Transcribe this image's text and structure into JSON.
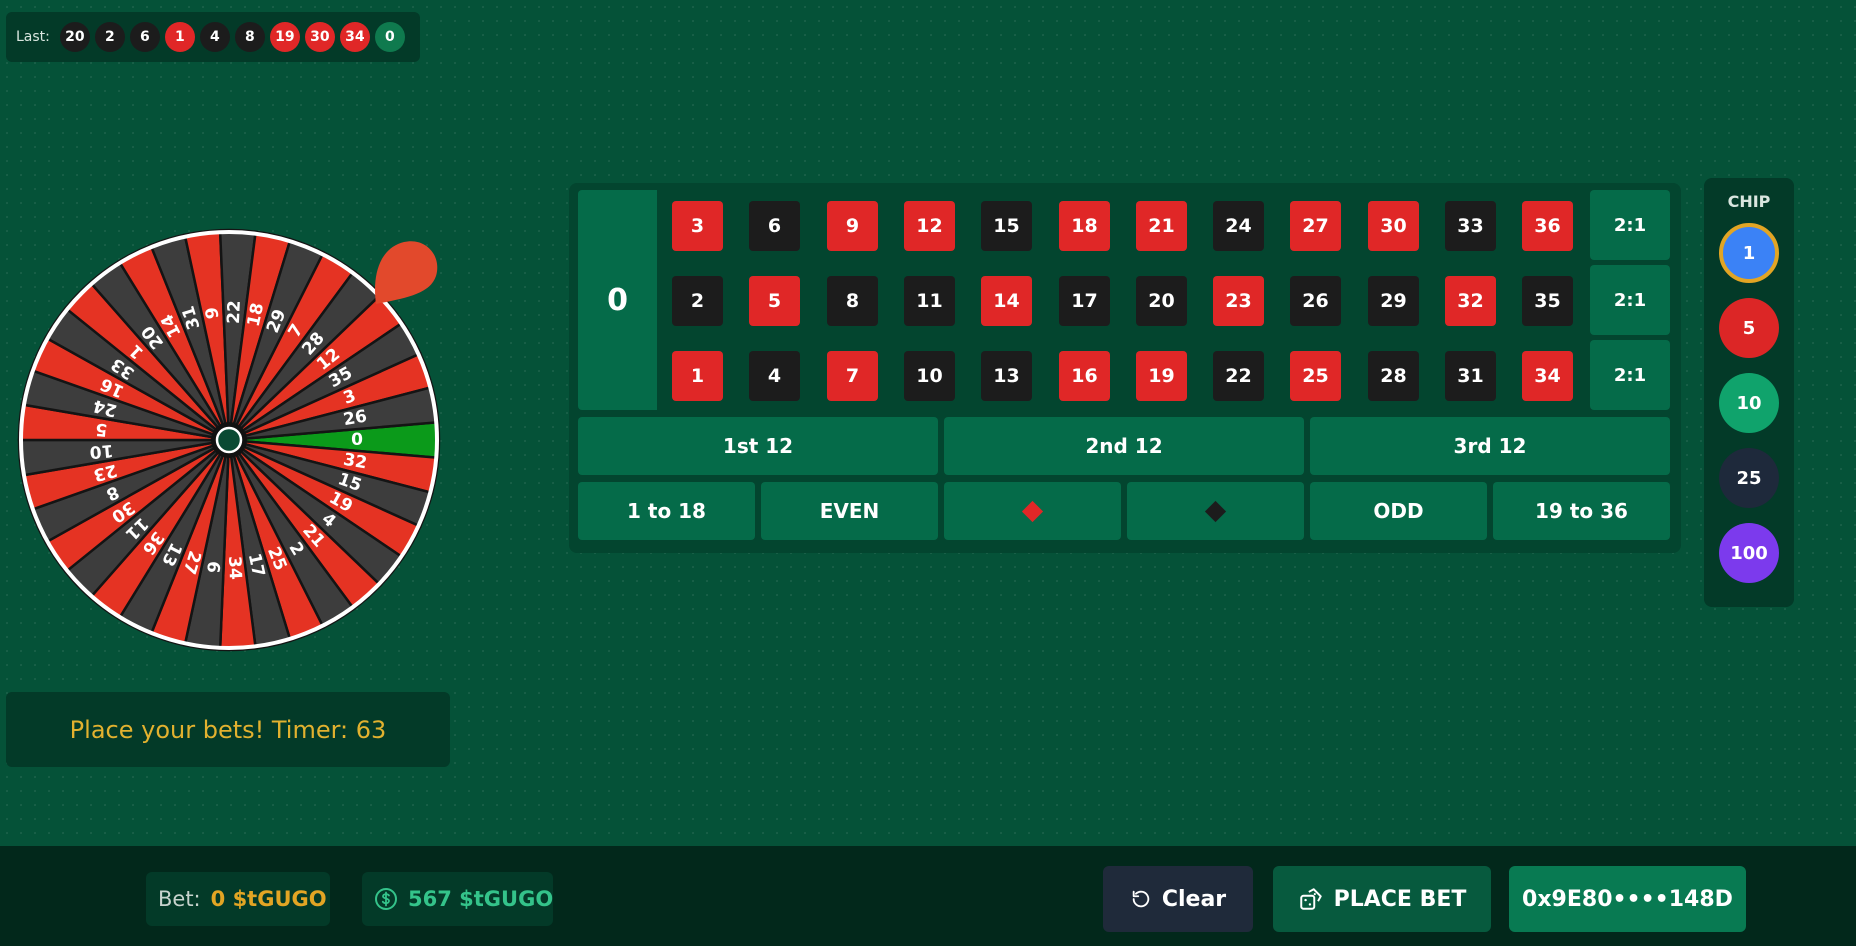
{
  "last_results": {
    "label": "Last:",
    "numbers": [
      {
        "value": "20",
        "color": "#1c1c1c"
      },
      {
        "value": "2",
        "color": "#1c1c1c"
      },
      {
        "value": "6",
        "color": "#1c1c1c"
      },
      {
        "value": "1",
        "color": "#e02727"
      },
      {
        "value": "4",
        "color": "#1c1c1c"
      },
      {
        "value": "8",
        "color": "#1c1c1c"
      },
      {
        "value": "19",
        "color": "#e02727"
      },
      {
        "value": "30",
        "color": "#e02727"
      },
      {
        "value": "34",
        "color": "#e02727"
      },
      {
        "value": "0",
        "color": "#0f7a4e"
      }
    ]
  },
  "wheel": {
    "sequence": [
      "0",
      "32",
      "15",
      "19",
      "4",
      "21",
      "2",
      "25",
      "17",
      "34",
      "6",
      "27",
      "13",
      "36",
      "11",
      "30",
      "8",
      "23",
      "10",
      "5",
      "24",
      "16",
      "33",
      "1",
      "20",
      "14",
      "31",
      "9",
      "22",
      "18",
      "29",
      "7",
      "28",
      "12",
      "35",
      "3",
      "26"
    ],
    "red_numbers": [
      1,
      3,
      5,
      7,
      9,
      12,
      14,
      16,
      18,
      19,
      21,
      23,
      25,
      27,
      30,
      32,
      34,
      36
    ],
    "colors": {
      "red": "#e53323",
      "black": "#3d3d3d",
      "green": "#0b9a1a",
      "rim": "#ffffff",
      "divider": "#141414",
      "pointer": "#e2492c"
    }
  },
  "status_message": "Place your bets! Timer: 63",
  "table": {
    "zero": "0",
    "rows": [
      [
        {
          "n": "3",
          "c": "red"
        },
        {
          "n": "6",
          "c": "black"
        },
        {
          "n": "9",
          "c": "red"
        },
        {
          "n": "12",
          "c": "red"
        },
        {
          "n": "15",
          "c": "black"
        },
        {
          "n": "18",
          "c": "red"
        },
        {
          "n": "21",
          "c": "red"
        },
        {
          "n": "24",
          "c": "black"
        },
        {
          "n": "27",
          "c": "red"
        },
        {
          "n": "30",
          "c": "red"
        },
        {
          "n": "33",
          "c": "black"
        },
        {
          "n": "36",
          "c": "red"
        }
      ],
      [
        {
          "n": "2",
          "c": "black"
        },
        {
          "n": "5",
          "c": "red"
        },
        {
          "n": "8",
          "c": "black"
        },
        {
          "n": "11",
          "c": "black"
        },
        {
          "n": "14",
          "c": "red"
        },
        {
          "n": "17",
          "c": "black"
        },
        {
          "n": "20",
          "c": "black"
        },
        {
          "n": "23",
          "c": "red"
        },
        {
          "n": "26",
          "c": "black"
        },
        {
          "n": "29",
          "c": "black"
        },
        {
          "n": "32",
          "c": "red"
        },
        {
          "n": "35",
          "c": "black"
        }
      ],
      [
        {
          "n": "1",
          "c": "red"
        },
        {
          "n": "4",
          "c": "black"
        },
        {
          "n": "7",
          "c": "red"
        },
        {
          "n": "10",
          "c": "black"
        },
        {
          "n": "13",
          "c": "black"
        },
        {
          "n": "16",
          "c": "red"
        },
        {
          "n": "19",
          "c": "red"
        },
        {
          "n": "22",
          "c": "black"
        },
        {
          "n": "25",
          "c": "red"
        },
        {
          "n": "28",
          "c": "black"
        },
        {
          "n": "31",
          "c": "black"
        },
        {
          "n": "34",
          "c": "red"
        }
      ]
    ],
    "column_bets": [
      "2:1",
      "2:1",
      "2:1"
    ],
    "dozens": [
      "1st 12",
      "2nd 12",
      "3rd 12"
    ],
    "low_label": "1 to 18",
    "even_label": "EVEN",
    "odd_label": "ODD",
    "high_label": "19 to 36",
    "colors": {
      "red": "#e02727",
      "black": "#1c1c1c"
    }
  },
  "chips": {
    "title": "CHIP",
    "items": [
      {
        "value": "1",
        "color": "#3b82f6",
        "selected": true
      },
      {
        "value": "5",
        "color": "#dc2626",
        "selected": false
      },
      {
        "value": "10",
        "color": "#10a36c",
        "selected": false
      },
      {
        "value": "25",
        "color": "#1e293b",
        "selected": false
      },
      {
        "value": "100",
        "color": "#7c3aed",
        "selected": false
      }
    ],
    "selected_ring_color": "#e2a524"
  },
  "footer": {
    "bet_label": "Bet:",
    "bet_value": "0 $tGUGO",
    "balance_value": "567 $tGUGO",
    "clear_label": "Clear",
    "place_bet_label": "PLACE BET",
    "wallet_label": "0x9E80••••148D"
  }
}
